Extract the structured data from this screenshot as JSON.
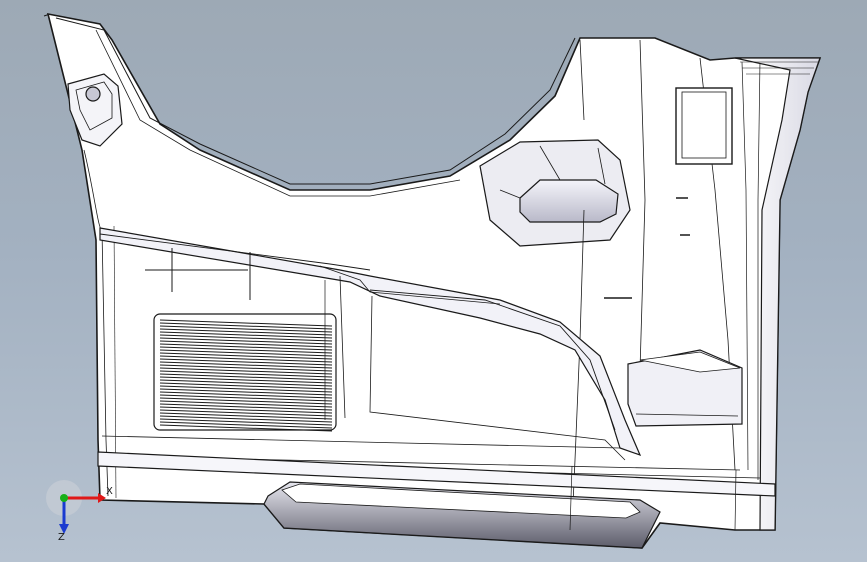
{
  "viewport": {
    "background_top": "#9da9b5",
    "background_bottom": "#b6c2d0",
    "model_fill": "#ffffff",
    "edge_color": "#1a1a1a"
  },
  "triad": {
    "x_label": "X",
    "z_label": "Z",
    "x_color": "#e01818",
    "y_color": "#18b018",
    "z_color": "#1a3ad0"
  }
}
